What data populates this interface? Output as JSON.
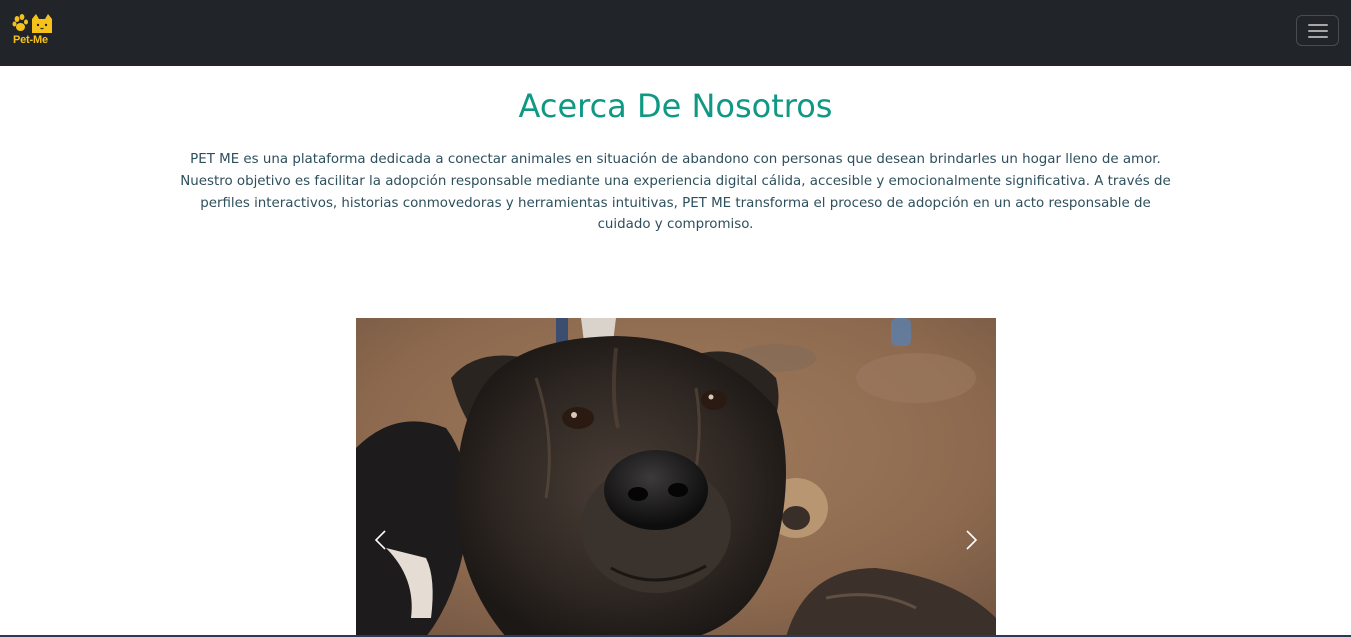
{
  "navbar": {
    "brand_text": "Pet-Me",
    "logo_icon": "paw-cat-logo-icon",
    "toggler_icon": "hamburger-menu-icon",
    "background": "#212529",
    "brand_color": "#f6c21a"
  },
  "about": {
    "title": "Acerca De Nosotros",
    "description": "PET ME es una plataforma dedicada a conectar animales en situación de abandono con personas que desean brindarles un hogar lleno de amor. Nuestro objetivo es facilitar la adopción responsable mediante una experiencia digital cálida, accesible y emocionalmente significativa. A través de perfiles interactivos, historias conmovedoras y herramientas intuitivas, PET ME transforma el proceso de adopción en un acto responsable de cuidado y compromiso.",
    "title_color": "#0f9884",
    "text_color": "#2d4f5c"
  },
  "carousel": {
    "prev_icon": "chevron-left-icon",
    "next_icon": "chevron-right-icon"
  }
}
